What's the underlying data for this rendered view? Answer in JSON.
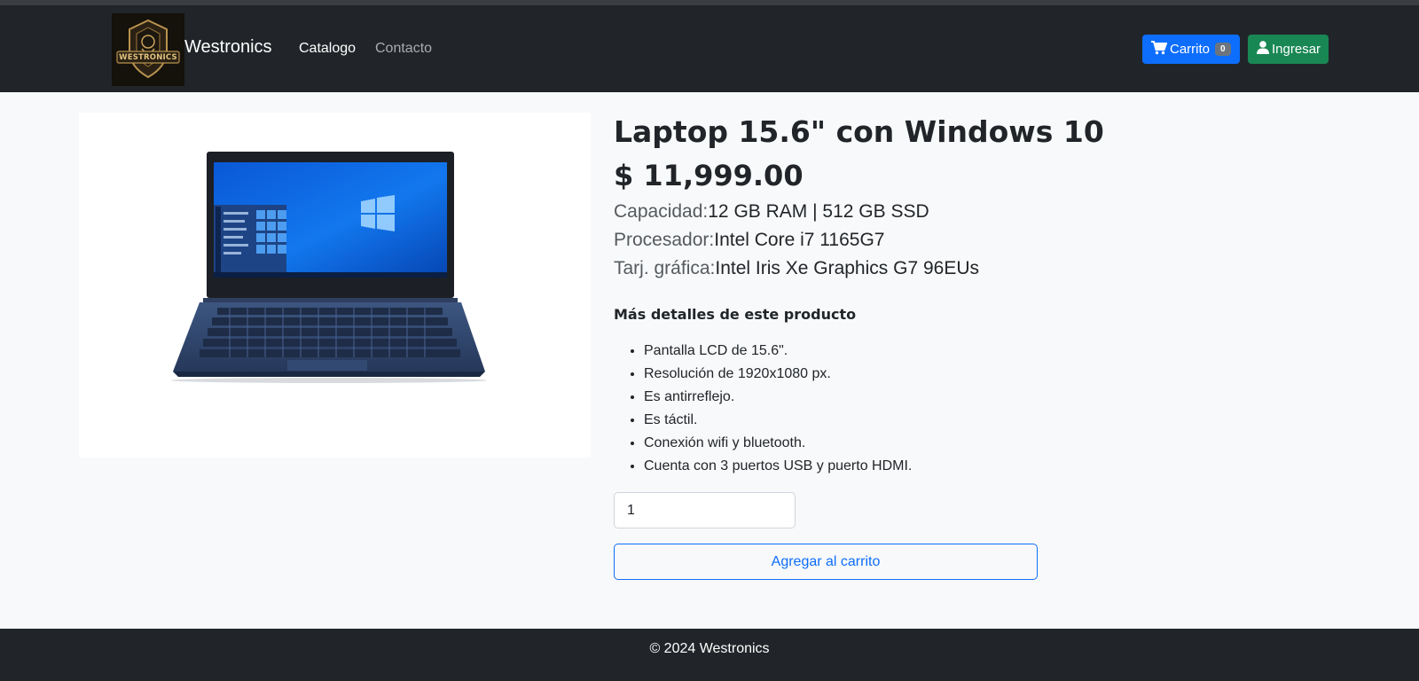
{
  "navbar": {
    "logo_text": "WESTRONICS",
    "brand": "Westronics",
    "links": [
      {
        "label": "Catalogo",
        "active": true
      },
      {
        "label": "Contacto",
        "active": false
      }
    ],
    "cart": {
      "icon": "cart-icon",
      "label": "Carrito",
      "count": "0",
      "color": "#0d6efd"
    },
    "login": {
      "icon": "user-icon",
      "label": "Ingresar",
      "color": "#198754"
    }
  },
  "product": {
    "image": "laptop-image",
    "title": "Laptop 15.6\" con Windows 10",
    "price": "$ 11,999.00",
    "specs": [
      {
        "key": "Capacidad:",
        "value": "12 GB RAM | 512 GB SSD"
      },
      {
        "key": "Procesador:",
        "value": "Intel Core i7 1165G7"
      },
      {
        "key": "Tarj. gráfica:",
        "value": "Intel Iris Xe Graphics G7 96EUs"
      }
    ],
    "details_heading": "Más detalles de este producto",
    "features": [
      "Pantalla LCD de 15.6\".",
      "Resolución de 1920x1080 px.",
      "Es antirreflejo.",
      "Es táctil.",
      "Conexión wifi y bluetooth.",
      "Cuenta con 3 puertos USB y puerto HDMI."
    ],
    "quantity": "1",
    "add_button": "Agregar al carrito"
  },
  "footer": {
    "text": "© 2024 Westronics"
  }
}
